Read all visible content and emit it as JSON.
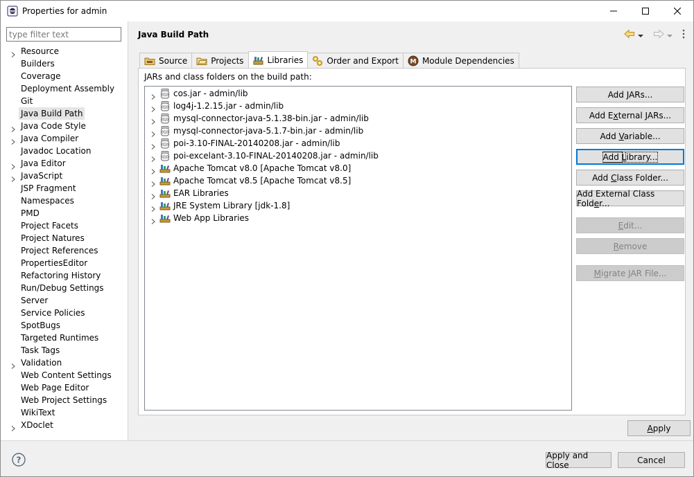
{
  "window": {
    "title": "Properties for admin"
  },
  "filter": {
    "placeholder": "type filter text",
    "value": ""
  },
  "nav": {
    "items": [
      {
        "label": "Resource",
        "expandable": true
      },
      {
        "label": "Builders",
        "expandable": false
      },
      {
        "label": "Coverage",
        "expandable": false
      },
      {
        "label": "Deployment Assembly",
        "expandable": false
      },
      {
        "label": "Git",
        "expandable": false
      },
      {
        "label": "Java Build Path",
        "expandable": false,
        "selected": true
      },
      {
        "label": "Java Code Style",
        "expandable": true
      },
      {
        "label": "Java Compiler",
        "expandable": true
      },
      {
        "label": "Javadoc Location",
        "expandable": false
      },
      {
        "label": "Java Editor",
        "expandable": true
      },
      {
        "label": "JavaScript",
        "expandable": true
      },
      {
        "label": "JSP Fragment",
        "expandable": false
      },
      {
        "label": "Namespaces",
        "expandable": false
      },
      {
        "label": "PMD",
        "expandable": false
      },
      {
        "label": "Project Facets",
        "expandable": false
      },
      {
        "label": "Project Natures",
        "expandable": false
      },
      {
        "label": "Project References",
        "expandable": false
      },
      {
        "label": "PropertiesEditor",
        "expandable": false
      },
      {
        "label": "Refactoring History",
        "expandable": false
      },
      {
        "label": "Run/Debug Settings",
        "expandable": false
      },
      {
        "label": "Server",
        "expandable": false
      },
      {
        "label": "Service Policies",
        "expandable": false
      },
      {
        "label": "SpotBugs",
        "expandable": false
      },
      {
        "label": "Targeted Runtimes",
        "expandable": false
      },
      {
        "label": "Task Tags",
        "expandable": false
      },
      {
        "label": "Validation",
        "expandable": true
      },
      {
        "label": "Web Content Settings",
        "expandable": false
      },
      {
        "label": "Web Page Editor",
        "expandable": false
      },
      {
        "label": "Web Project Settings",
        "expandable": false
      },
      {
        "label": "WikiText",
        "expandable": false
      },
      {
        "label": "XDoclet",
        "expandable": true
      }
    ]
  },
  "page": {
    "title": "Java Build Path"
  },
  "tabs": [
    {
      "label": "Source",
      "icon": "source-folder-icon",
      "active": false
    },
    {
      "label": "Projects",
      "icon": "projects-icon",
      "active": false
    },
    {
      "label": "Libraries",
      "icon": "libraries-icon",
      "active": true
    },
    {
      "label": "Order and Export",
      "icon": "order-export-icon",
      "active": false
    },
    {
      "label": "Module Dependencies",
      "icon": "module-icon",
      "active": false
    }
  ],
  "libraries": {
    "caption": "JARs and class folders on the build path:",
    "entries": [
      {
        "label": "cos.jar - admin/lib",
        "icon": "jar-icon"
      },
      {
        "label": "log4j-1.2.15.jar - admin/lib",
        "icon": "jar-icon"
      },
      {
        "label": "mysql-connector-java-5.1.38-bin.jar - admin/lib",
        "icon": "jar-icon"
      },
      {
        "label": "mysql-connector-java-5.1.7-bin.jar - admin/lib",
        "icon": "jar-icon"
      },
      {
        "label": "poi-3.10-FINAL-20140208.jar - admin/lib",
        "icon": "jar-icon"
      },
      {
        "label": "poi-excelant-3.10-FINAL-20140208.jar - admin/lib",
        "icon": "jar-icon"
      },
      {
        "label": "Apache Tomcat v8.0 [Apache Tomcat v8.0]",
        "icon": "library-icon"
      },
      {
        "label": "Apache Tomcat v8.5 [Apache Tomcat v8.5]",
        "icon": "library-icon"
      },
      {
        "label": "EAR Libraries",
        "icon": "library-icon"
      },
      {
        "label": "JRE System Library [jdk-1.8]",
        "icon": "library-icon"
      },
      {
        "label": "Web App Libraries",
        "icon": "library-icon"
      }
    ]
  },
  "buttons": {
    "add_jars": {
      "pre": "Add ",
      "key": "J",
      "post": "ARs..."
    },
    "add_external_jars": {
      "pre": "Add E",
      "key": "x",
      "post": "ternal JARs..."
    },
    "add_variable": {
      "pre": "Add ",
      "key": "V",
      "post": "ariable..."
    },
    "add_library": {
      "pre": "Add ",
      "key": "L",
      "post": "ibrary..."
    },
    "add_class_folder": {
      "pre": "Add ",
      "key": "C",
      "post": "lass Folder..."
    },
    "add_external_class_folder": {
      "pre": "Add External Class Fold",
      "key": "e",
      "post": "r..."
    },
    "edit": {
      "pre": "",
      "key": "E",
      "post": "dit..."
    },
    "remove": {
      "pre": "",
      "key": "R",
      "post": "emove"
    },
    "migrate_jar": {
      "pre": "",
      "key": "M",
      "post": "igrate JAR File..."
    },
    "apply": {
      "pre": "",
      "key": "A",
      "post": "pply"
    },
    "apply_and_close": "Apply and Close",
    "cancel": "Cancel"
  }
}
